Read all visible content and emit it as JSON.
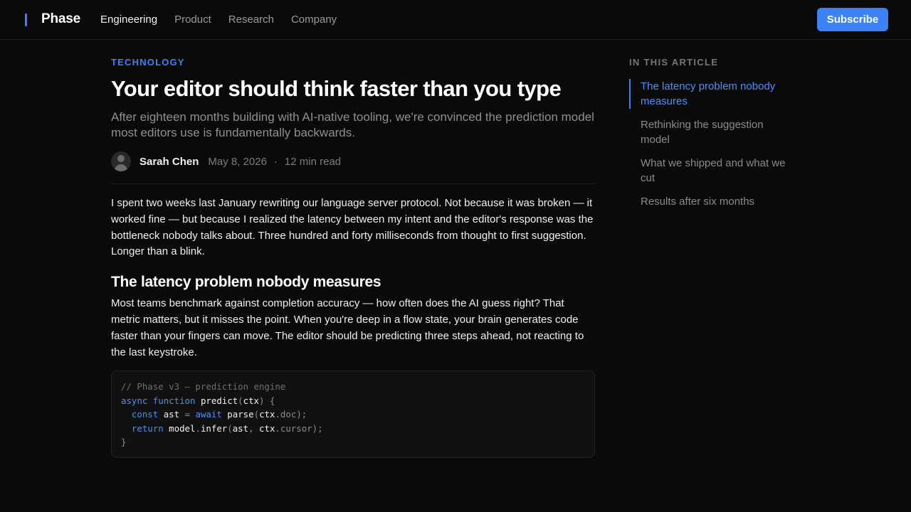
{
  "nav": {
    "logo": "Phase",
    "links": [
      {
        "label": "Engineering",
        "active": true
      },
      {
        "label": "Product",
        "active": false
      },
      {
        "label": "Research",
        "active": false
      },
      {
        "label": "Company",
        "active": false
      }
    ],
    "subscribe_label": "Subscribe"
  },
  "article": {
    "category": "TECHNOLOGY",
    "title": "Your editor should think faster than you type",
    "subtitle": "After eighteen months building with AI-native tooling, we're convinced the prediction model most editors use is fundamentally backwards.",
    "author": "Sarah Chen",
    "date": "May 8, 2026",
    "separator": "·",
    "read_time": "12 min read",
    "paragraph_1": "I spent two weeks last January rewriting our language server protocol. Not because it was broken — it worked fine — but because I realized the latency between my intent and the editor's response was the bottleneck nobody talks about. Three hundred and forty milliseconds from thought to first suggestion. Longer than a blink.",
    "heading_1": "The latency problem nobody measures",
    "paragraph_2": "Most teams benchmark against completion accuracy — how often does the AI guess right? That metric matters, but it misses the point. When you're deep in a flow state, your brain generates code faster than your fingers can move. The editor should be predicting three steps ahead, not reacting to the last keystroke.",
    "code": {
      "comment": "// Phase v3 — prediction engine",
      "l2_kw1": "async",
      "l2_kw2": "function",
      "l2_fn": "predict",
      "l2_arg": "ctx",
      "l3_kw1": "const",
      "l3_var": "ast",
      "l3_kw2": "await",
      "l3_fn": "parse",
      "l3_obj": "ctx",
      "l3_prop": "doc",
      "l4_kw": "return",
      "l4_obj": "model",
      "l4_fn": "infer",
      "l4_a1": "ast",
      "l4_a2": "ctx",
      "l4_prop": "cursor",
      "close": "}"
    }
  },
  "toc": {
    "heading": "IN THIS ARTICLE",
    "items": [
      {
        "label": "The latency problem nobody measures",
        "active": true
      },
      {
        "label": "Rethinking the suggestion model",
        "active": false
      },
      {
        "label": "What we shipped and what we cut",
        "active": false
      },
      {
        "label": "Results after six months",
        "active": false
      }
    ]
  },
  "colors": {
    "accent": "#3b82f6",
    "background": "#0a0a0a"
  }
}
